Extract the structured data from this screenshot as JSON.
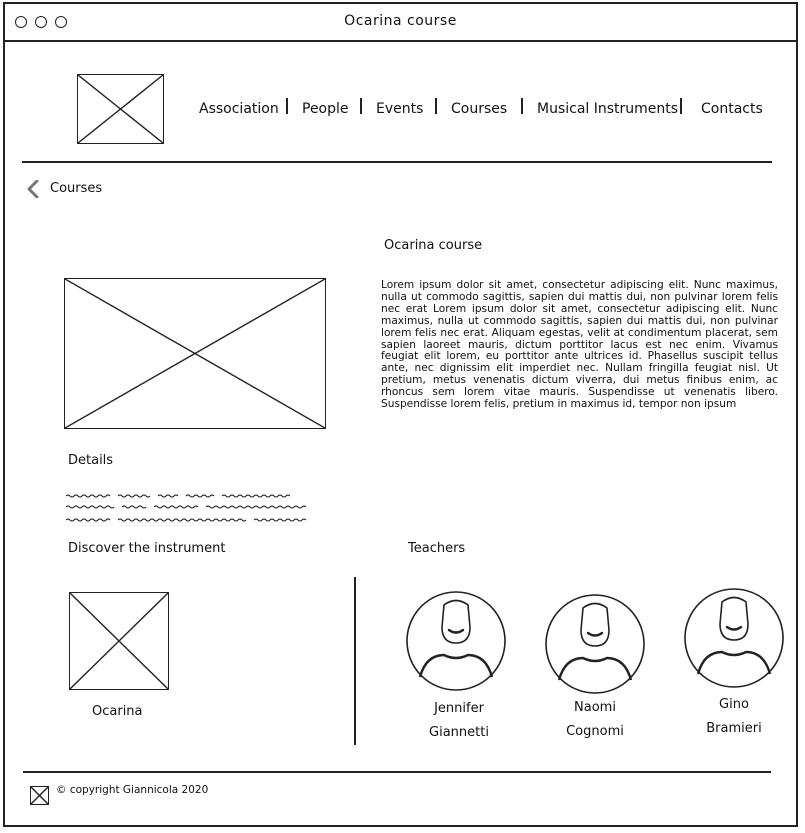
{
  "window": {
    "title": "Ocarina course"
  },
  "nav": {
    "items": [
      {
        "label": "Association"
      },
      {
        "label": "People"
      },
      {
        "label": "Events"
      },
      {
        "label": "Courses"
      },
      {
        "label": "Musical Instruments"
      },
      {
        "label": "Contacts"
      }
    ]
  },
  "breadcrumb": {
    "label": "Courses"
  },
  "course": {
    "title": "Ocarina course",
    "description": "Lorem ipsum dolor sit amet, consectetur adipiscing elit. Nunc maximus, nulla ut commodo sagittis, sapien dui mattis dui, non pulvinar lorem felis nec erat Lorem ipsum dolor sit amet, consectetur adipiscing elit. Nunc maximus, nulla ut commodo sagittis, sapien dui mattis dui, non pulvinar lorem felis nec erat. Aliquam egestas, velit at condimentum placerat, sem sapien laoreet mauris, dictum porttitor lacus est nec enim. Vivamus feugiat elit lorem, eu porttitor ante ultrices id. Phasellus suscipit tellus ante, nec dignissim elit imperdiet nec. Nullam fringilla feugiat nisl. Ut pretium, metus venenatis dictum viverra, dui metus finibus enim, ac rhoncus sem lorem vitae mauris. Suspendisse ut venenatis libero. Suspendisse lorem felis, pretium in maximus id, tempor non ipsum"
  },
  "details": {
    "heading": "Details"
  },
  "instrument": {
    "heading": "Discover the instrument",
    "name": "Ocarina"
  },
  "teachers": {
    "heading": "Teachers",
    "list": [
      {
        "first": "Jennifer",
        "last": "Giannetti"
      },
      {
        "first": "Naomi",
        "last": "Cognomi"
      },
      {
        "first": "Gino",
        "last": "Bramieri"
      }
    ]
  },
  "footer": {
    "copyright": "© copyright Giannicola 2020"
  },
  "icons": {
    "back": "chevron-left-icon",
    "placeholder": "image-placeholder-icon",
    "avatar": "user-avatar-icon"
  },
  "colors": {
    "ink": "#222222",
    "background": "#ffffff",
    "chevron": "#777777"
  }
}
